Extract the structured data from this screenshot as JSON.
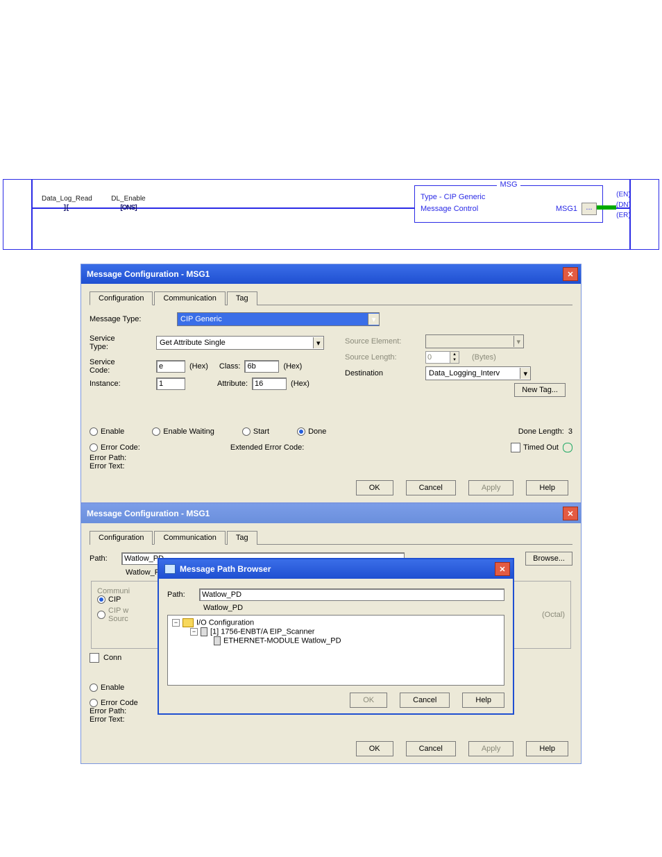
{
  "ladder": {
    "contact1": "Data_Log_Read",
    "contact2": "DL_Enable",
    "ons": "ONS",
    "msg_title": "MSG",
    "msg_type_line": "Type - CIP Generic",
    "msg_ctrl_label": "Message Control",
    "msg_tag": "MSG1",
    "en": "EN",
    "dn": "DN",
    "er": "ER"
  },
  "dlg1": {
    "title": "Message Configuration - MSG1",
    "tab_config": "Configuration",
    "tab_comm": "Communication",
    "tab_tag": "Tag",
    "message_type_label": "Message Type:",
    "message_type_value": "CIP Generic",
    "service_type_label": "Service\nType:",
    "service_type_value": "Get Attribute Single",
    "service_code_label": "Service\nCode:",
    "service_code_value": "e",
    "instance_label": "Instance:",
    "instance_value": "1",
    "hex": "(Hex)",
    "class_label": "Class:",
    "class_value": "6b",
    "attribute_label": "Attribute:",
    "attribute_value": "16",
    "source_element_label": "Source Element:",
    "source_length_label": "Source Length:",
    "source_length_value": "0",
    "bytes": "(Bytes)",
    "destination_label": "Destination",
    "destination_value": "Data_Logging_Interv",
    "new_tag": "New Tag...",
    "enable": "Enable",
    "enable_waiting": "Enable Waiting",
    "start": "Start",
    "done": "Done",
    "done_length_label": "Done Length:",
    "done_length_value": "3",
    "error_code": "Error Code:",
    "ext_error": "Extended Error Code:",
    "timed_out": "Timed Out",
    "error_path": "Error Path:",
    "error_text": "Error Text:",
    "ok": "OK",
    "cancel": "Cancel",
    "apply": "Apply",
    "help": "Help"
  },
  "dlg2": {
    "title": "Message Configuration - MSG1",
    "tab_config": "Configuration",
    "tab_comm": "Communication",
    "tab_tag": "Tag",
    "path_label": "Path:",
    "path_value": "Watlow_PD",
    "path_echo": "Watlow_PD",
    "browse": "Browse...",
    "comm_legend": "Communi",
    "cip": "CIP",
    "cip_w_source": "CIP w\nSourc",
    "connected": "Conn",
    "octal": "(Octal)",
    "enable": "Enable",
    "error_code": "Error Code",
    "error_path": "Error Path:",
    "error_text": "Error Text:",
    "ok": "OK",
    "cancel": "Cancel",
    "apply": "Apply",
    "help": "Help"
  },
  "browser": {
    "title": "Message Path Browser",
    "path_label": "Path:",
    "path_value": "Watlow_PD",
    "path_echo": "Watlow_PD",
    "tree_root": "I/O Configuration",
    "tree_l2": "[1] 1756-ENBT/A EIP_Scanner",
    "tree_l3": "ETHERNET-MODULE Watlow_PD",
    "ok": "OK",
    "cancel": "Cancel",
    "help": "Help"
  }
}
